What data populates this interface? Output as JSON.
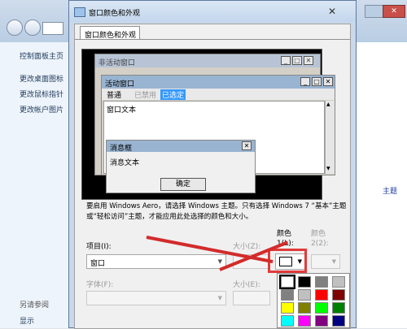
{
  "background": {
    "sidebar_links": [
      "控制面板主页",
      "更改桌面图标",
      "更改鼠标指针",
      "更改帐户图片"
    ],
    "see_also": "另请参阅",
    "display": "显示",
    "right_link": "主题"
  },
  "dialog": {
    "title": "窗口颜色和外观",
    "tab": "窗口颜色和外观",
    "close_symbol": "✕"
  },
  "preview": {
    "inactive_window": "非活动窗口",
    "active_window": "活动窗口",
    "menu_normal": "普通",
    "menu_disabled": "已禁用",
    "menu_selected": "已选定",
    "window_text": "窗口文本",
    "msgbox_title": "消息框",
    "msgbox_text": "消息文本",
    "ok_button": "确定"
  },
  "info_text": "要启用 Windows Aero，请选择 Windows 主题。只有选择 Windows 7 “基本”主题或“轻松访问”主题，才能应用此处选择的颜色和大小。",
  "form": {
    "item_label": "项目(I):",
    "item_value": "窗口",
    "size_label": "大小(Z):",
    "color1_label": "颜色\n1(L):",
    "color2_label": "颜色\n2(2):",
    "font_label": "字体(F):",
    "font_size_label": "大小(E):"
  },
  "colors": {
    "palette": [
      "#ffffff",
      "#000000",
      "#808080",
      "#c0c0c0",
      "#808080",
      "#c0c0c0",
      "#ff0000",
      "#800000",
      "#ffff00",
      "#808000",
      "#00ff00",
      "#008000",
      "#00ffff",
      "#ff00ff",
      "#800080",
      "#000080"
    ],
    "annotation": "#e23a3a"
  }
}
